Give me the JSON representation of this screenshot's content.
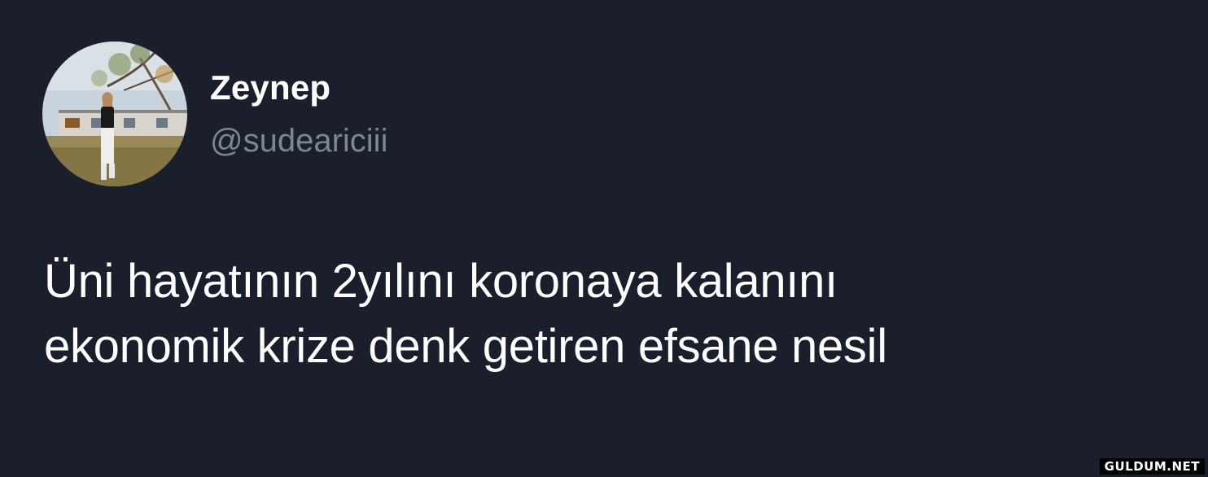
{
  "tweet": {
    "author": {
      "display_name": "Zeynep",
      "handle": "@sudeariciii",
      "avatar_icon": "profile-photo"
    },
    "text_lines": [
      "Üni hayatının 2yılını koronaya kalanını",
      "ekonomik krize denk getiren efsane nesil"
    ]
  },
  "watermark": {
    "text": "GULDUM.NET"
  },
  "colors": {
    "background": "#1a1f2b",
    "primary_text": "#ffffff",
    "secondary_text": "#7d8794"
  }
}
